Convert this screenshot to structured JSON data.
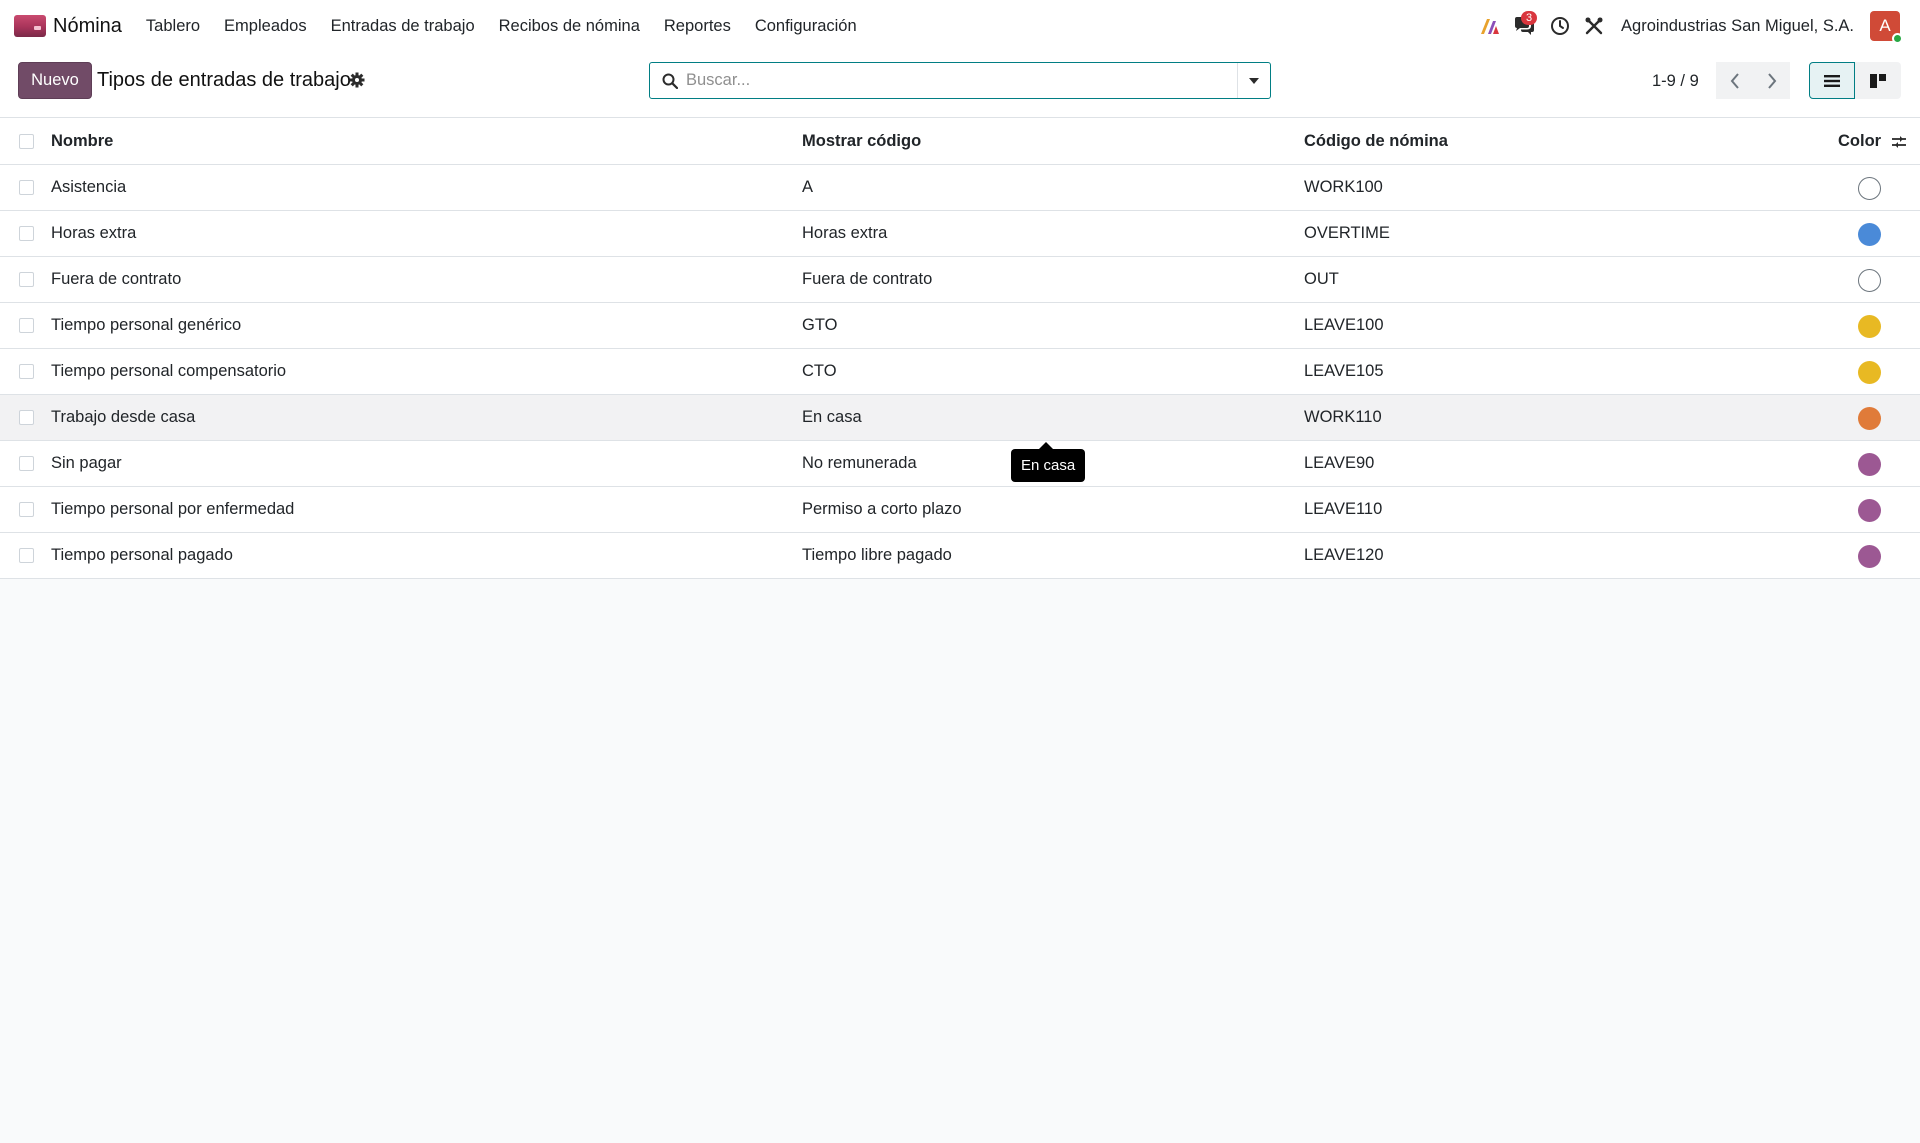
{
  "navbar": {
    "app_name": "Nómina",
    "menu": [
      "Tablero",
      "Empleados",
      "Entradas de trabajo",
      "Recibos de nómina",
      "Reportes",
      "Configuración"
    ],
    "messages_count": "3",
    "company": "Agroindustrias San Miguel, S.A.",
    "avatar_letter": "A"
  },
  "control": {
    "new_label": "Nuevo",
    "title": "Tipos de entradas de trabajo",
    "search_placeholder": "Buscar...",
    "pager": "1-9 / 9"
  },
  "table": {
    "columns": {
      "name": "Nombre",
      "display_code": "Mostrar código",
      "payroll_code": "Código de nómina",
      "color": "Color"
    },
    "rows": [
      {
        "name": "Asistencia",
        "display_code": "A",
        "payroll_code": "WORK100",
        "color": null
      },
      {
        "name": "Horas extra",
        "display_code": "Horas extra",
        "payroll_code": "OVERTIME",
        "color": "#4a8ad8"
      },
      {
        "name": "Fuera de contrato",
        "display_code": "Fuera de contrato",
        "payroll_code": "OUT",
        "color": null
      },
      {
        "name": "Tiempo personal genérico",
        "display_code": "GTO",
        "payroll_code": "LEAVE100",
        "color": "#e8b923"
      },
      {
        "name": "Tiempo personal compensatorio",
        "display_code": "CTO",
        "payroll_code": "LEAVE105",
        "color": "#e8b923"
      },
      {
        "name": "Trabajo desde casa",
        "display_code": "En casa",
        "payroll_code": "WORK110",
        "color": "#e07b39"
      },
      {
        "name": "Sin pagar",
        "display_code": "No remunerada",
        "payroll_code": "LEAVE90",
        "color": "#9c5893"
      },
      {
        "name": "Tiempo personal por enfermedad",
        "display_code": "Permiso a corto plazo",
        "payroll_code": "LEAVE110",
        "color": "#9c5893"
      },
      {
        "name": "Tiempo personal pagado",
        "display_code": "Tiempo libre pagado",
        "payroll_code": "LEAVE120",
        "color": "#9c5893"
      }
    ],
    "hovered_row": 5
  },
  "tooltip": {
    "text": "En casa"
  },
  "colors": {
    "brand": "#714b67",
    "accent": "#017e84",
    "danger": "#d9363e"
  }
}
